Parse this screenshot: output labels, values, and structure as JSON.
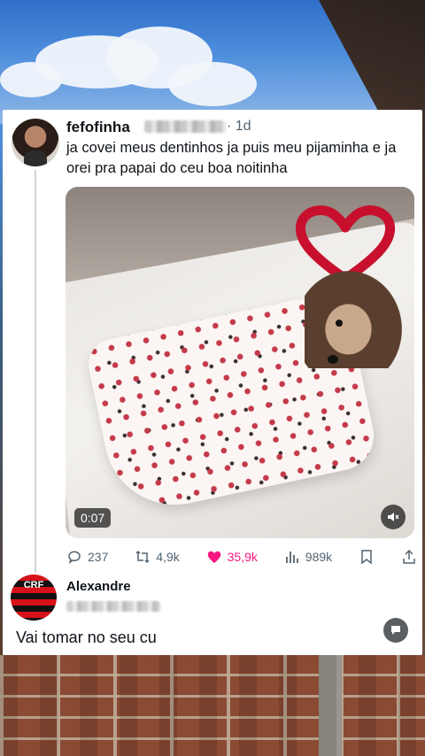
{
  "tweet": {
    "display_name": "fefofinha",
    "time": "· 1d",
    "text": "ja covei meus dentinhos ja puis meu pijaminha e ja orei pra papai do ceu boa noitinha",
    "video": {
      "duration": "0:07"
    },
    "actions": {
      "replies": "237",
      "retweets": "4,9k",
      "likes": "35,9k",
      "views": "989k"
    }
  },
  "reply": {
    "display_name": "Alexandre",
    "text": "Vai tomar no seu cu"
  },
  "colors": {
    "like": "#f91880",
    "text": "#0f1419",
    "muted": "#536471"
  },
  "icons": [
    "reply-icon",
    "retweet-icon",
    "heart-icon",
    "views-icon",
    "bookmark-icon",
    "share-icon",
    "mute-icon"
  ]
}
